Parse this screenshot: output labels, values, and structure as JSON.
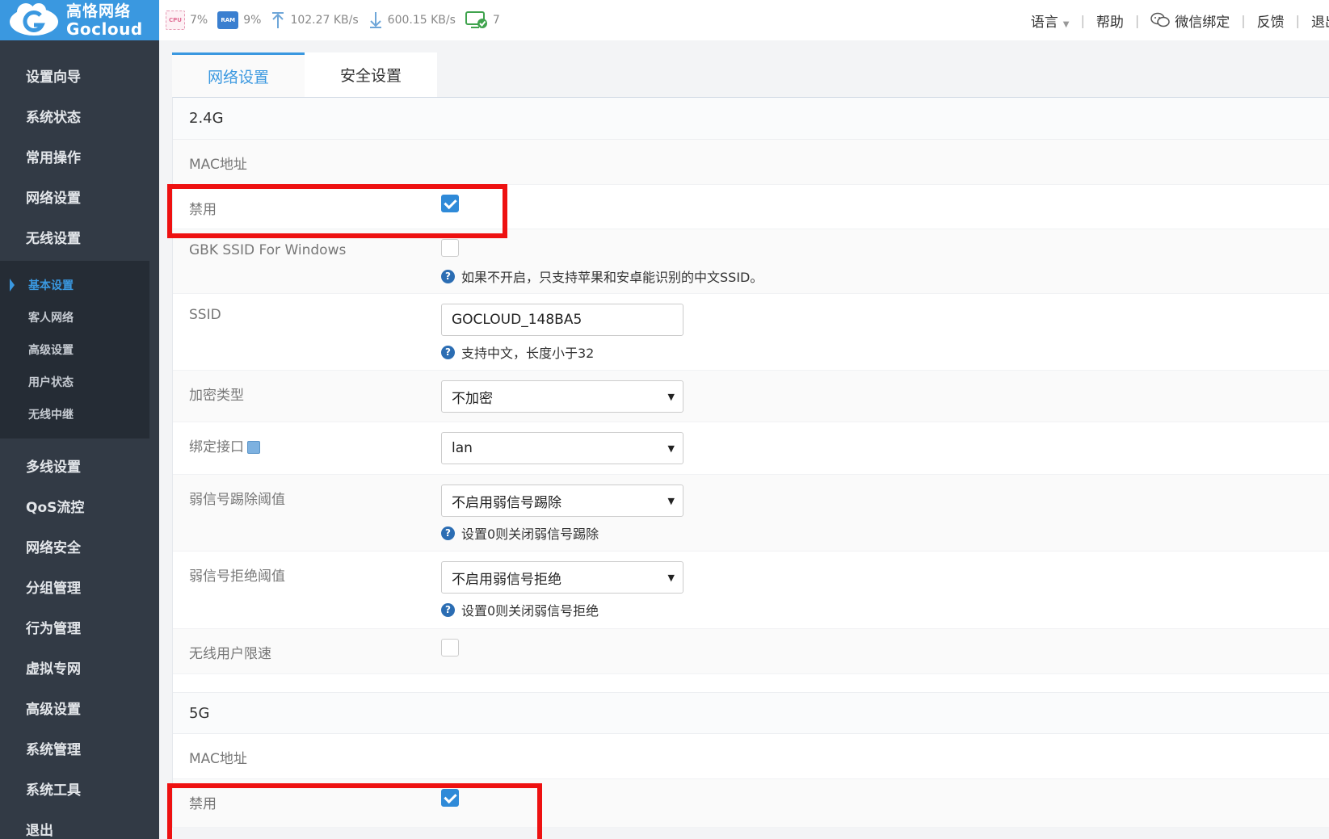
{
  "header": {
    "logo_cn": "高恪网络",
    "logo_en": "Gocloud",
    "cpu_chip": "CPU",
    "cpu_value": "7%",
    "ram_chip": "RAM",
    "ram_value": "9%",
    "upload_value": "102.27 KB/s",
    "download_value": "600.15 KB/s",
    "devices_value": "7",
    "nav": {
      "language": "语言",
      "help": "帮助",
      "wechat": "微信绑定",
      "feedback": "反馈",
      "logout": "退出"
    }
  },
  "sidebar": {
    "items_top": [
      "设置向导",
      "系统状态",
      "常用操作",
      "网络设置",
      "无线设置"
    ],
    "sub_items": [
      "基本设置",
      "客人网络",
      "高级设置",
      "用户状态",
      "无线中继"
    ],
    "items_bottom": [
      "多线设置",
      "QoS流控",
      "网络安全",
      "分组管理",
      "行为管理",
      "虚拟专网",
      "高级设置",
      "系统管理",
      "系统工具",
      "退出"
    ]
  },
  "tabs": [
    "网络设置",
    "安全设置"
  ],
  "section_24g": {
    "title": "2.4G",
    "mac_label": "MAC地址",
    "disable_label": "禁用",
    "disable_checked": true,
    "gbk_label": "GBK SSID For Windows",
    "gbk_checked": false,
    "gbk_hint": "如果不开启，只支持苹果和安卓能识别的中文SSID。",
    "ssid_label": "SSID",
    "ssid_value": "GOCLOUD_148BA5",
    "ssid_hint": "支持中文，长度小于32",
    "encrypt_label": "加密类型",
    "encrypt_value": "不加密",
    "iface_label": "绑定接口",
    "iface_value": "lan",
    "weak_kick_label": "弱信号踢除阈值",
    "weak_kick_value": "不启用弱信号踢除",
    "weak_kick_hint": "设置0则关闭弱信号踢除",
    "weak_reject_label": "弱信号拒绝阈值",
    "weak_reject_value": "不启用弱信号拒绝",
    "weak_reject_hint": "设置0则关闭弱信号拒绝",
    "rate_limit_label": "无线用户限速",
    "rate_limit_checked": false
  },
  "section_5g": {
    "title": "5G",
    "mac_label": "MAC地址",
    "disable_label": "禁用",
    "disable_checked": true
  },
  "colors": {
    "accent": "#3a98e0",
    "sidebar_bg": "#323a45",
    "highlight_box": "#ee1111"
  }
}
